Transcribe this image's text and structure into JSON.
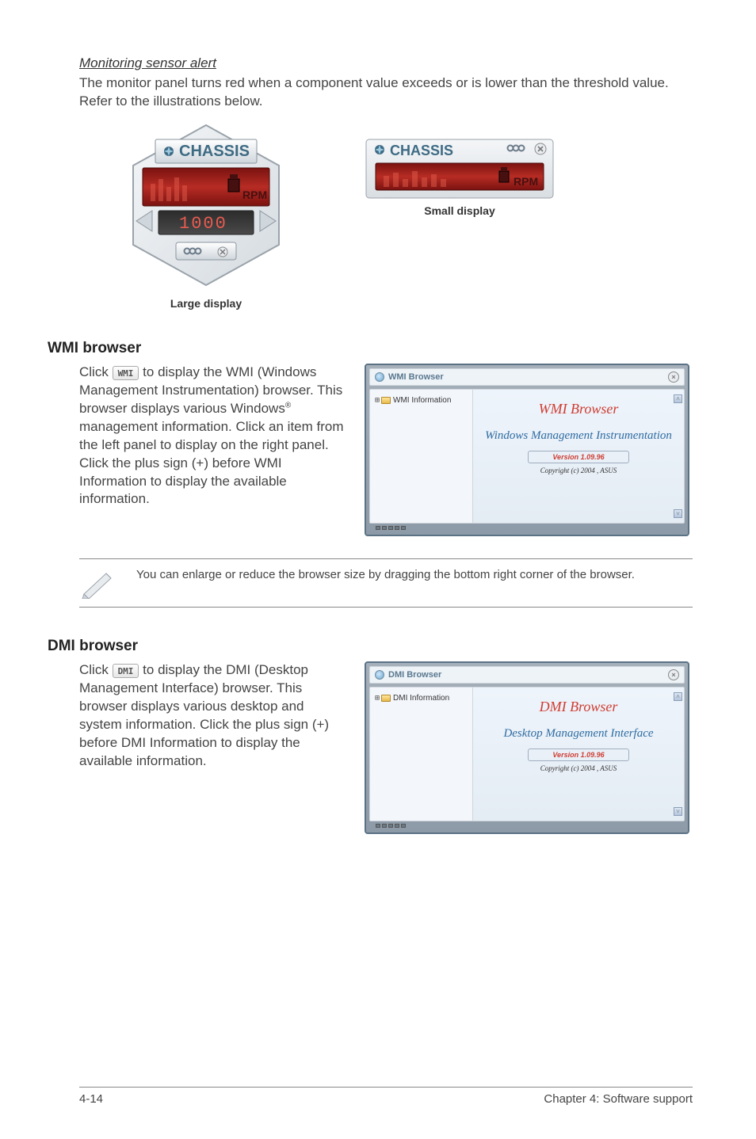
{
  "monitoring": {
    "heading": "Monitoring sensor alert",
    "text": "The monitor panel turns red when a component value exceeds or is lower than the threshold value. Refer to the illustrations below.",
    "chassis_label": "CHASSIS",
    "large": {
      "caption": "Large display",
      "rpm_unit": "RPM",
      "bottom_value": "1000"
    },
    "small": {
      "caption": "Small display",
      "rpm_unit": "RPM"
    }
  },
  "wmi": {
    "title": "WMI browser",
    "text_part1": "Click ",
    "chip": "WMI",
    "text_part2": "to display the WMI (Windows Management Instrumentation) browser. This browser displays various Windows",
    "text_part3": " management information. Click an item from the left panel to display on the right panel. Click the plus sign (+) before WMI Information to display the available information.",
    "panel": {
      "titlebar": "WMI Browser",
      "tree_label": "WMI Information",
      "content_title": "WMI Browser",
      "content_sub": "Windows Management Instrumentation",
      "version": "Version 1.09.96",
      "copyright": "Copyright (c) 2004 , ASUS"
    }
  },
  "note": {
    "text": "You can enlarge or reduce the browser size by dragging the bottom right corner of the browser."
  },
  "dmi": {
    "title": "DMI browser",
    "text_part1": "Click ",
    "chip": "DMI",
    "text_part2": "to display the DMI (Desktop Management Interface) browser. This browser displays various desktop and system information. Click the plus sign (+) before DMI Information to display the available information.",
    "panel": {
      "titlebar": "DMI Browser",
      "tree_label": "DMI Information",
      "content_title": "DMI Browser",
      "content_sub": "Desktop Management Interface",
      "version": "Version 1.09.96",
      "copyright": "Copyright (c) 2004 , ASUS"
    }
  },
  "footer": {
    "page": "4-14",
    "chapter": "Chapter 4: Software support"
  },
  "reg_mark": "®"
}
